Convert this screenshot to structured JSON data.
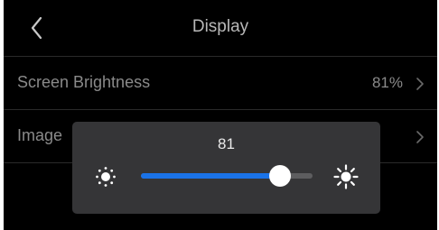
{
  "header": {
    "title": "Display",
    "back_icon": "chevron-left-icon"
  },
  "settings": [
    {
      "label": "Screen Brightness",
      "value": "81%",
      "icon": "chevron-right-icon"
    },
    {
      "label": "Image",
      "value": "",
      "icon": "chevron-right-icon"
    }
  ],
  "brightness_popup": {
    "value": "81",
    "level_percent": 81,
    "min_icon": "sun-small-icon",
    "max_icon": "sun-large-icon",
    "accent_color": "#1a73e8"
  }
}
